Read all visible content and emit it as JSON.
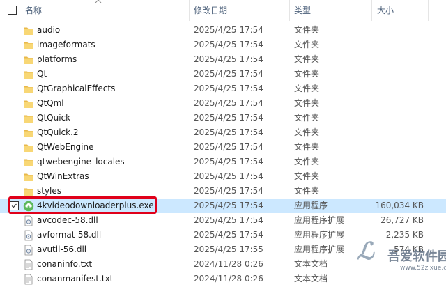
{
  "columns": {
    "name": "名称",
    "date": "修改日期",
    "type": "类型",
    "size": "大小"
  },
  "rows": [
    {
      "name": "audio",
      "date": "2025/4/25 17:54",
      "type": "文件夹",
      "size": "",
      "icon": "folder-icon"
    },
    {
      "name": "imageformats",
      "date": "2025/4/25 17:54",
      "type": "文件夹",
      "size": "",
      "icon": "folder-icon"
    },
    {
      "name": "platforms",
      "date": "2025/4/25 17:54",
      "type": "文件夹",
      "size": "",
      "icon": "folder-icon"
    },
    {
      "name": "Qt",
      "date": "2025/4/25 17:54",
      "type": "文件夹",
      "size": "",
      "icon": "folder-icon"
    },
    {
      "name": "QtGraphicalEffects",
      "date": "2025/4/25 17:54",
      "type": "文件夹",
      "size": "",
      "icon": "folder-icon"
    },
    {
      "name": "QtQml",
      "date": "2025/4/25 17:54",
      "type": "文件夹",
      "size": "",
      "icon": "folder-icon"
    },
    {
      "name": "QtQuick",
      "date": "2025/4/25 17:54",
      "type": "文件夹",
      "size": "",
      "icon": "folder-icon"
    },
    {
      "name": "QtQuick.2",
      "date": "2025/4/25 17:54",
      "type": "文件夹",
      "size": "",
      "icon": "folder-icon"
    },
    {
      "name": "QtWebEngine",
      "date": "2025/4/25 17:54",
      "type": "文件夹",
      "size": "",
      "icon": "folder-icon"
    },
    {
      "name": "qtwebengine_locales",
      "date": "2025/4/25 17:54",
      "type": "文件夹",
      "size": "",
      "icon": "folder-icon"
    },
    {
      "name": "QtWinExtras",
      "date": "2025/4/25 17:54",
      "type": "文件夹",
      "size": "",
      "icon": "folder-icon"
    },
    {
      "name": "styles",
      "date": "2025/4/25 17:54",
      "type": "文件夹",
      "size": "",
      "icon": "folder-icon"
    },
    {
      "name": "4kvideodownloaderplus.exe",
      "date": "2025/4/25 17:54",
      "type": "应用程序",
      "size": "160,034 KB",
      "icon": "app-icon",
      "selected": true
    },
    {
      "name": "avcodec-58.dll",
      "date": "2025/4/25 17:54",
      "type": "应用程序扩展",
      "size": "26,727 KB",
      "icon": "dll-icon"
    },
    {
      "name": "avformat-58.dll",
      "date": "2025/4/25 17:54",
      "type": "应用程序扩展",
      "size": "2,235 KB",
      "icon": "dll-icon"
    },
    {
      "name": "avutil-56.dll",
      "date": "2025/4/25 17:55",
      "type": "应用程序扩展",
      "size": "574 KB",
      "icon": "dll-icon"
    },
    {
      "name": "conaninfo.txt",
      "date": "2024/11/28 0:26",
      "type": "文本文档",
      "size": "",
      "icon": "text-file-icon"
    },
    {
      "name": "conanmanifest.txt",
      "date": "2024/11/28 0:26",
      "type": "文本文档",
      "size": "",
      "icon": "text-file-icon"
    }
  ],
  "watermark": {
    "text": "吾爱软件园",
    "url": "www.52zixue.com"
  },
  "colors": {
    "selected_bg": "#cce8ff",
    "highlight_border": "#e0001a",
    "folder": "#f8d775"
  }
}
